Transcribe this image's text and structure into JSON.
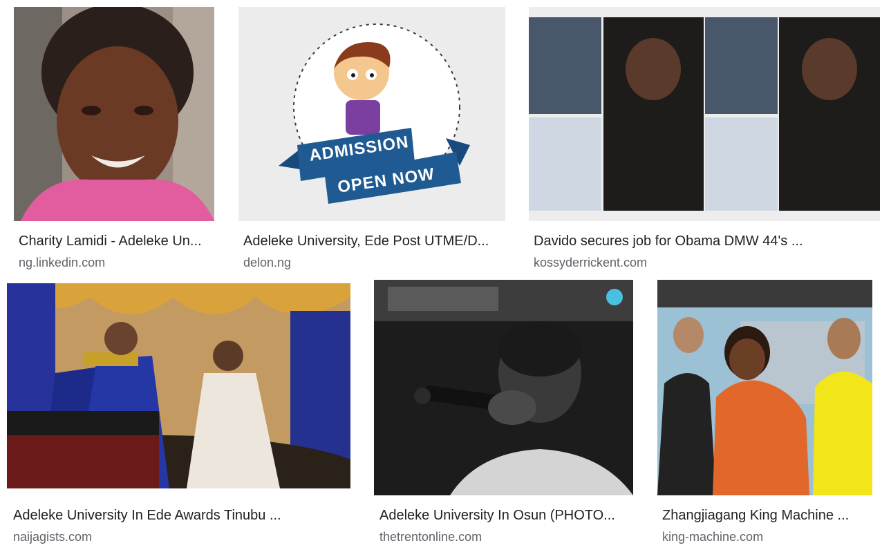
{
  "results": [
    {
      "title": "Charity Lamidi - Adeleke Un...",
      "source": "ng.linkedin.com"
    },
    {
      "title": "Adeleke University, Ede Post UTME/D...",
      "source": "delon.ng",
      "image_text": {
        "line1": "ADMISSION",
        "line2": "OPEN NOW"
      }
    },
    {
      "title": "Davido secures job for Obama DMW 44's ...",
      "source": "kossyderrickent.com"
    },
    {
      "title": "Adeleke University In Ede Awards Tinubu ...",
      "source": "naijagists.com"
    },
    {
      "title": "Adeleke University In Osun (PHOTO...",
      "source": "thetrentonline.com"
    },
    {
      "title": "Zhangjiagang King Machine ...",
      "source": "king-machine.com"
    }
  ],
  "colors": {
    "title": "#202124",
    "source": "#5f6368",
    "banner_blue": "#1f5a92"
  }
}
